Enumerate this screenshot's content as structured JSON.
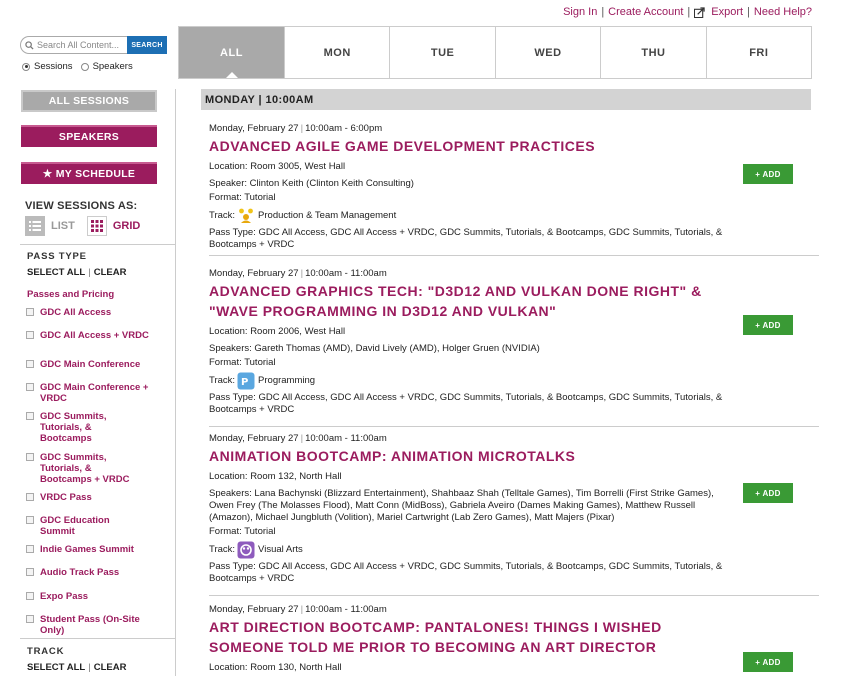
{
  "header": {
    "links": [
      "Sign In",
      "Create Account",
      "Export",
      "Need Help?"
    ]
  },
  "search": {
    "placeholder": "Search All Content...",
    "button_label": "SEARCH",
    "radio_options": [
      "Sessions",
      "Speakers"
    ],
    "selected_option": "Sessions"
  },
  "day_tabs": {
    "tabs": [
      "ALL",
      "MON",
      "TUE",
      "WED",
      "THU",
      "FRI"
    ],
    "active": "ALL"
  },
  "sidebar": {
    "all_sessions": "ALL SESSIONS",
    "speakers": "SPEAKERS",
    "my_schedule": "★ MY SCHEDULE",
    "view_sessions_as": "VIEW SESSIONS AS:",
    "view_list": "LIST",
    "view_grid": "GRID",
    "pass_type_title": "PASS TYPE",
    "select_all": "SELECT ALL",
    "clear": "CLEAR",
    "passes_and_pricing": "Passes and Pricing",
    "pass_items": [
      "GDC All Access",
      "GDC All Access + VRDC",
      "GDC Main Conference",
      "GDC Main Conference + VRDC",
      "GDC Summits, Tutorials, & Bootcamps",
      "GDC Summits, Tutorials, & Bootcamps + VRDC",
      "VRDC Pass",
      "GDC Education Summit",
      "Indie Games Summit",
      "Audio Track Pass",
      "Expo Pass",
      "Student Pass (On-Site Only)"
    ],
    "track_title": "TRACK",
    "track_select_all": "SELECT ALL",
    "track_clear": "CLEAR"
  },
  "main": {
    "slot_header": "MONDAY | 10:00AM",
    "add_label": "+ ADD",
    "sessions": [
      {
        "date": "Monday, February 27",
        "time": "10:00am - 6:00pm",
        "title": "ADVANCED AGILE GAME DEVELOPMENT PRACTICES",
        "location": "Location:  Room 3005, West Hall",
        "speakers": "Speaker:  Clinton Keith (Clinton Keith Consulting)",
        "format": "Format: Tutorial",
        "track_label": "Track:",
        "track_name": "Production & Team Management",
        "track_icon": "team-icon",
        "pass_type": "Pass Type: GDC All Access, GDC All Access + VRDC, GDC Summits, Tutorials, & Bootcamps, GDC Summits, Tutorials, & Bootcamps + VRDC"
      },
      {
        "date": "Monday, February 27",
        "time": "10:00am - 11:00am",
        "title": "ADVANCED GRAPHICS TECH: \"D3D12 AND VULKAN DONE RIGHT\" & \"WAVE PROGRAMMING IN D3D12 AND VULKAN\"",
        "location": "Location:  Room 2006, West Hall",
        "speakers": "Speakers: Gareth Thomas (AMD), David Lively (AMD), Holger Gruen (NVIDIA)",
        "format": "Format: Tutorial",
        "track_label": "Track:",
        "track_name": "Programming",
        "track_icon": "programming-icon",
        "pass_type": "Pass Type: GDC All Access, GDC All Access + VRDC, GDC Summits, Tutorials, & Bootcamps, GDC Summits, Tutorials, & Bootcamps + VRDC"
      },
      {
        "date": "Monday, February 27",
        "time": "10:00am - 11:00am",
        "title": "ANIMATION BOOTCAMP: ANIMATION MICROTALKS",
        "location": "Location:  Room 132, North Hall",
        "speakers": "Speakers:  Lana Bachynski (Blizzard Entertainment), Shahbaaz Shah (Telltale Games), Tim Borrelli (First Strike Games), Owen Frey (The Molasses Flood), Matt Conn (MidBoss), Gabriela Aveiro (Dames Making Games), Matthew Russell (Amazon), Michael Jungbluth (Volition), Mariel Cartwright (Lab Zero Games), Matt Majers (Pixar)",
        "format": "Format: Tutorial",
        "track_label": "Track:",
        "track_name": "Visual Arts",
        "track_icon": "visual-arts-icon",
        "pass_type": "Pass Type: GDC All Access, GDC All Access + VRDC, GDC Summits, Tutorials, & Bootcamps, GDC Summits, Tutorials, & Bootcamps + VRDC"
      },
      {
        "date": "Monday, February 27",
        "time": "10:00am - 11:00am",
        "title": "ART DIRECTION BOOTCAMP: PANTALONES! THINGS I WISHED SOMEONE TOLD ME PRIOR TO BECOMING AN ART DIRECTOR",
        "location": "Location:  Room 130, North Hall"
      }
    ]
  },
  "colors": {
    "accent": "#9b1c5e",
    "search_button": "#1d6fb4",
    "add_button": "#3a9a35",
    "tab_active": "#a9a9a9"
  }
}
